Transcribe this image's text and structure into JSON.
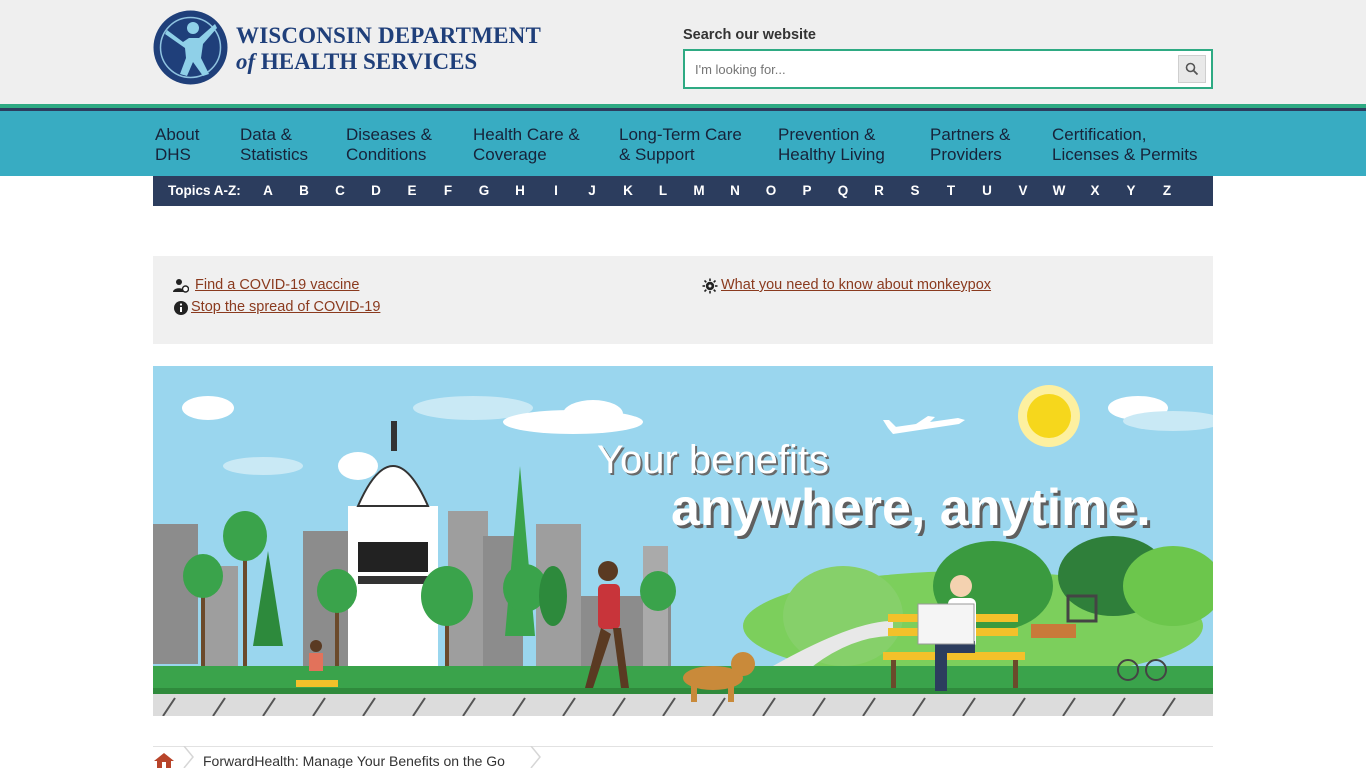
{
  "header": {
    "logo_line1": "WISCONSIN DEPARTMENT",
    "logo_of": "of",
    "logo_line2": "HEALTH SERVICES",
    "search_label": "Search our website",
    "search_placeholder": "I'm looking for...",
    "search_icon": "magnifier-icon"
  },
  "nav": [
    {
      "line1": "About",
      "line2": "DHS"
    },
    {
      "line1": "Data &",
      "line2": "Statistics"
    },
    {
      "line1": "Diseases &",
      "line2": "Conditions"
    },
    {
      "line1": "Health Care &",
      "line2": "Coverage"
    },
    {
      "line1": "Long-Term Care",
      "line2": "& Support"
    },
    {
      "line1": "Prevention &",
      "line2": "Healthy Living"
    },
    {
      "line1": "Partners &",
      "line2": "Providers"
    },
    {
      "line1": "Certification,",
      "line2": "Licenses & Permits"
    }
  ],
  "az": {
    "label": "Topics A-Z:",
    "letters": [
      "A",
      "B",
      "C",
      "D",
      "E",
      "F",
      "G",
      "H",
      "I",
      "J",
      "K",
      "L",
      "M",
      "N",
      "O",
      "P",
      "Q",
      "R",
      "S",
      "T",
      "U",
      "V",
      "W",
      "X",
      "Y",
      "Z"
    ]
  },
  "alerts": {
    "vaccine": "Find a COVID-19 vaccine",
    "spread": "Stop the spread of COVID-19",
    "monkeypox": "What you need to know about monkeypox"
  },
  "hero": {
    "line1": "Your benefits",
    "line2": "anywhere, anytime."
  },
  "breadcrumb": {
    "current": "ForwardHealth: Manage Your Benefits on the Go"
  },
  "colors": {
    "nav_bg": "#38acc2",
    "az_bg": "#2c3d5e",
    "accent_green": "#2eaa83",
    "link": "#8a3a1e",
    "logo_blue": "#1f3f7a"
  }
}
